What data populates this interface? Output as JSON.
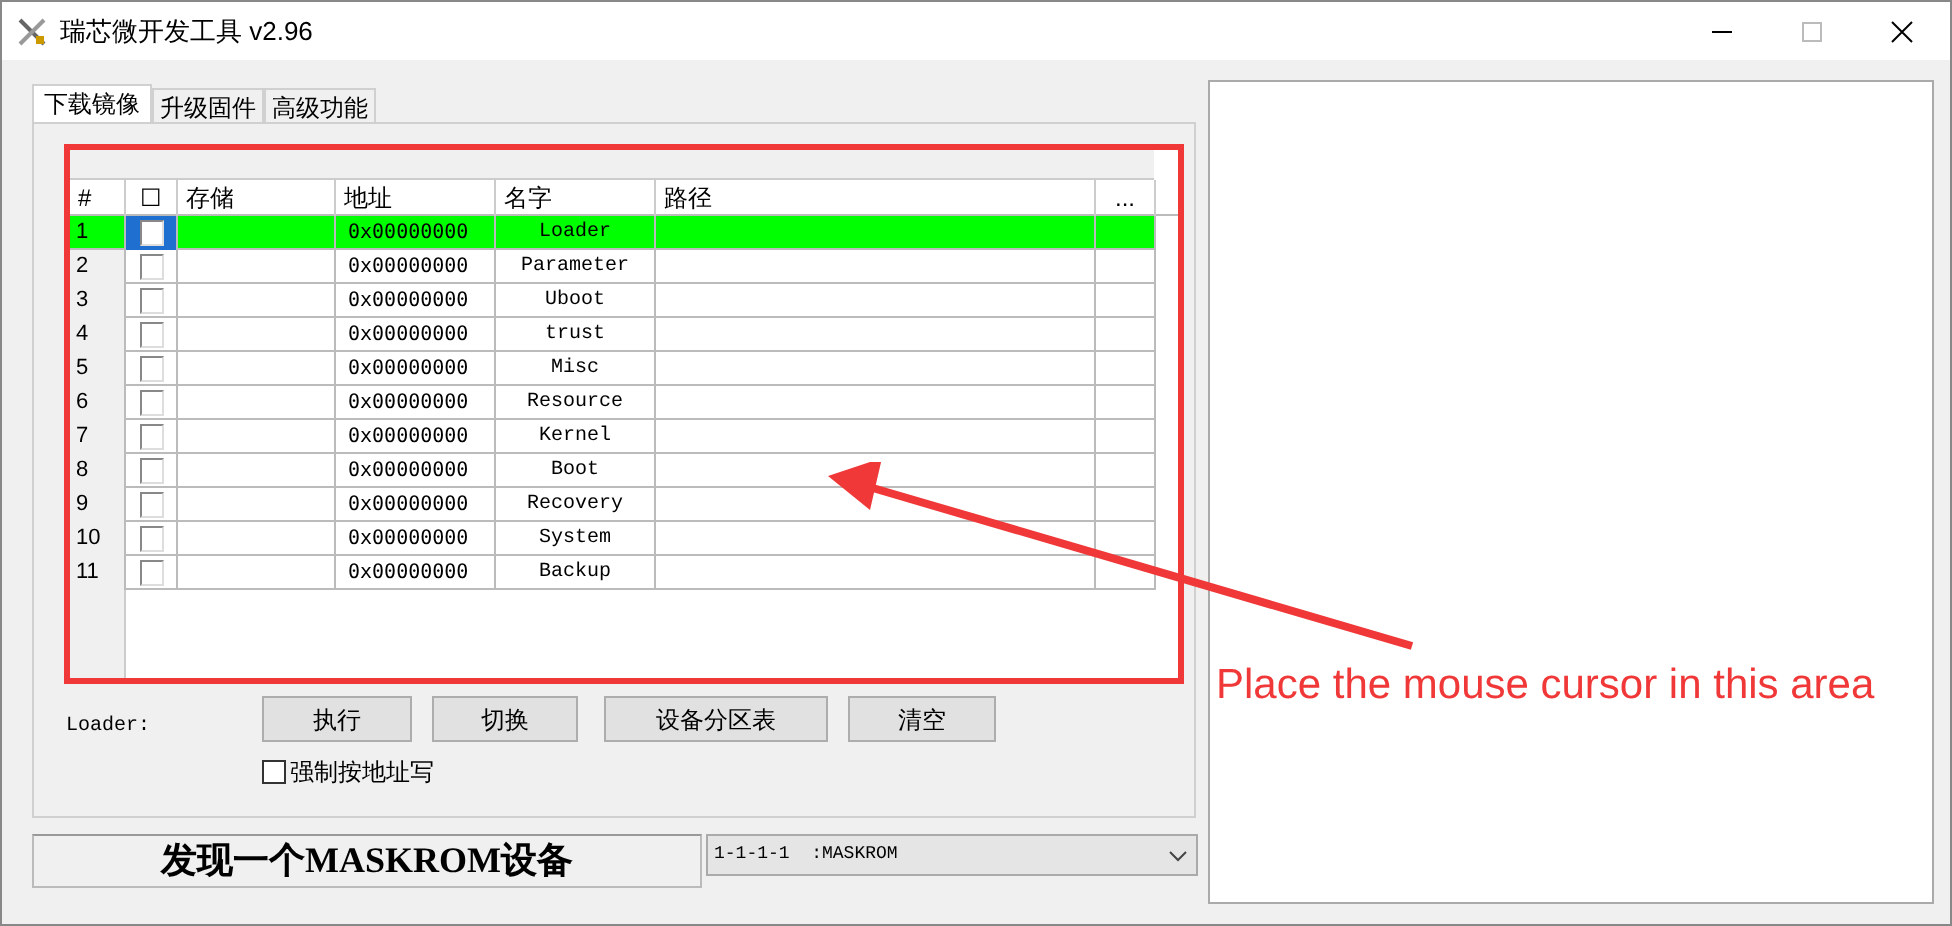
{
  "window": {
    "title": "瑞芯微开发工具 v2.96"
  },
  "tabs": [
    {
      "label": "下载镜像",
      "selected": true
    },
    {
      "label": "升级固件",
      "selected": false
    },
    {
      "label": "高级功能",
      "selected": false
    }
  ],
  "table": {
    "columns": [
      "#",
      "☐",
      "存储",
      "地址",
      "名字",
      "路径",
      "..."
    ],
    "rows": [
      {
        "index": "1",
        "checked": false,
        "selected": true,
        "address": "0x00000000",
        "name": "Loader"
      },
      {
        "index": "2",
        "checked": false,
        "selected": false,
        "address": "0x00000000",
        "name": "Parameter"
      },
      {
        "index": "3",
        "checked": false,
        "selected": false,
        "address": "0x00000000",
        "name": "Uboot"
      },
      {
        "index": "4",
        "checked": false,
        "selected": false,
        "address": "0x00000000",
        "name": "trust"
      },
      {
        "index": "5",
        "checked": false,
        "selected": false,
        "address": "0x00000000",
        "name": "Misc"
      },
      {
        "index": "6",
        "checked": false,
        "selected": false,
        "address": "0x00000000",
        "name": "Resource"
      },
      {
        "index": "7",
        "checked": false,
        "selected": false,
        "address": "0x00000000",
        "name": "Kernel"
      },
      {
        "index": "8",
        "checked": false,
        "selected": false,
        "address": "0x00000000",
        "name": "Boot"
      },
      {
        "index": "9",
        "checked": false,
        "selected": false,
        "address": "0x00000000",
        "name": "Recovery"
      },
      {
        "index": "10",
        "checked": false,
        "selected": false,
        "address": "0x00000000",
        "name": "System"
      },
      {
        "index": "11",
        "checked": false,
        "selected": false,
        "address": "0x00000000",
        "name": "Backup"
      }
    ]
  },
  "loader_label": "Loader:",
  "buttons": [
    "执行",
    "切换",
    "设备分区表",
    "清空"
  ],
  "force_address_write": {
    "label": "强制按地址写",
    "checked": false
  },
  "status": "发现一个MASKROM设备",
  "device_select": {
    "value": "1-1-1-1  :MASKROM"
  },
  "annotation": "Place the mouse cursor in this area"
}
